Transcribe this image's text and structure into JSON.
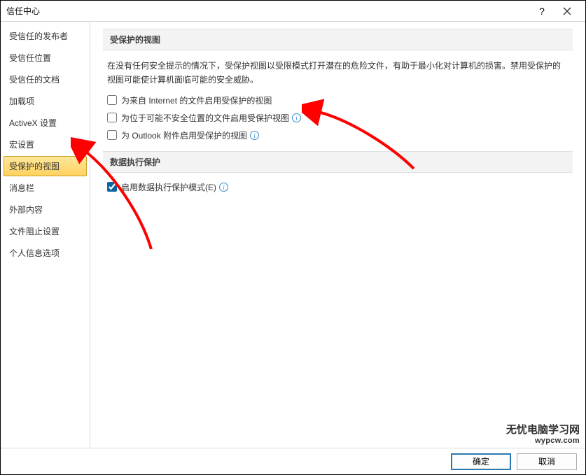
{
  "titlebar": {
    "title": "信任中心"
  },
  "sidebar": {
    "items": [
      {
        "label": "受信任的发布者",
        "selected": false
      },
      {
        "label": "受信任位置",
        "selected": false
      },
      {
        "label": "受信任的文档",
        "selected": false
      },
      {
        "label": "加载项",
        "selected": false
      },
      {
        "label": "ActiveX 设置",
        "selected": false
      },
      {
        "label": "宏设置",
        "selected": false
      },
      {
        "label": "受保护的视图",
        "selected": true
      },
      {
        "label": "消息栏",
        "selected": false
      },
      {
        "label": "外部内容",
        "selected": false
      },
      {
        "label": "文件阻止设置",
        "selected": false
      },
      {
        "label": "个人信息选项",
        "selected": false
      }
    ]
  },
  "section1": {
    "header": "受保护的视图",
    "desc": "在没有任何安全提示的情况下，受保护视图以受限模式打开潜在的危险文件，有助于最小化对计算机的损害。禁用受保护的视图可能使计算机面临可能的安全威胁。",
    "checks": [
      {
        "label": "为来自 Internet 的文件启用受保护的视图",
        "checked": false,
        "info": false
      },
      {
        "label": "为位于可能不安全位置的文件启用受保护视图",
        "checked": false,
        "info": true
      },
      {
        "label": "为 Outlook 附件启用受保护的视图",
        "checked": false,
        "info": true
      }
    ]
  },
  "section2": {
    "header": "数据执行保护",
    "checks": [
      {
        "label": "启用数据执行保护模式(E)",
        "checked": true,
        "info": true
      }
    ]
  },
  "footer": {
    "ok": "确定",
    "cancel": "取消"
  },
  "watermark": {
    "line1": "无忧电脑学习网",
    "line2": "wypcw.com"
  }
}
